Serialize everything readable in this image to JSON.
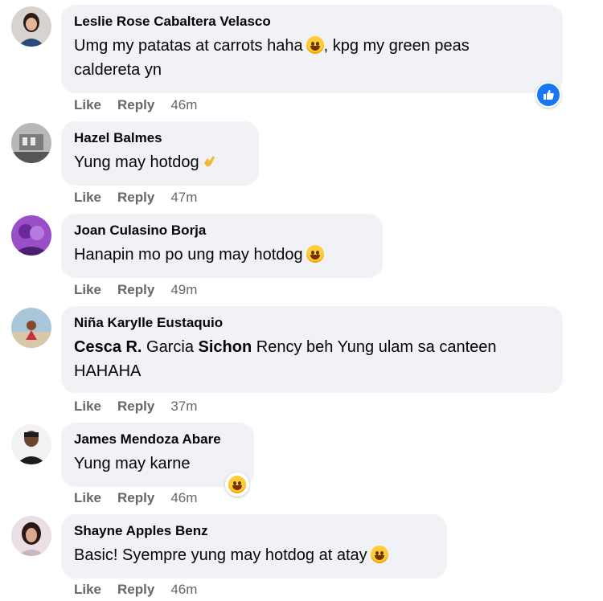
{
  "comments": [
    {
      "author": "Leslie Rose Cabaltera Velasco",
      "text_line1": "Umg my patatas at carrots haha",
      "text_line1b": ", kpg my green peas",
      "text_line2": "caldereta yn",
      "like": "Like",
      "reply": "Reply",
      "time": "46m",
      "reaction": "like-icon"
    },
    {
      "author": "Hazel Balmes",
      "text": "Yung may hotdog",
      "like": "Like",
      "reply": "Reply",
      "time": "47m"
    },
    {
      "author": "Joan Culasino Borja",
      "text": "Hanapin mo po ung may hotdog",
      "like": "Like",
      "reply": "Reply",
      "time": "49m"
    },
    {
      "author": "Niña Karylle Eustaquio",
      "mention1": "Cesca R.",
      "mid": " Garcia ",
      "mention2": "Sichon",
      "rest": " Rency beh Yung ulam sa canteen",
      "line2": "HAHAHA",
      "like": "Like",
      "reply": "Reply",
      "time": "37m"
    },
    {
      "author": "James Mendoza Abare",
      "text": "Yung may karne",
      "like": "Like",
      "reply": "Reply",
      "time": "46m",
      "reaction": "haha-emoji"
    },
    {
      "author": "Shayne Apples Benz",
      "text": "Basic! Syempre yung may hotdog at atay",
      "like": "Like",
      "reply": "Reply",
      "time": "46m"
    }
  ]
}
